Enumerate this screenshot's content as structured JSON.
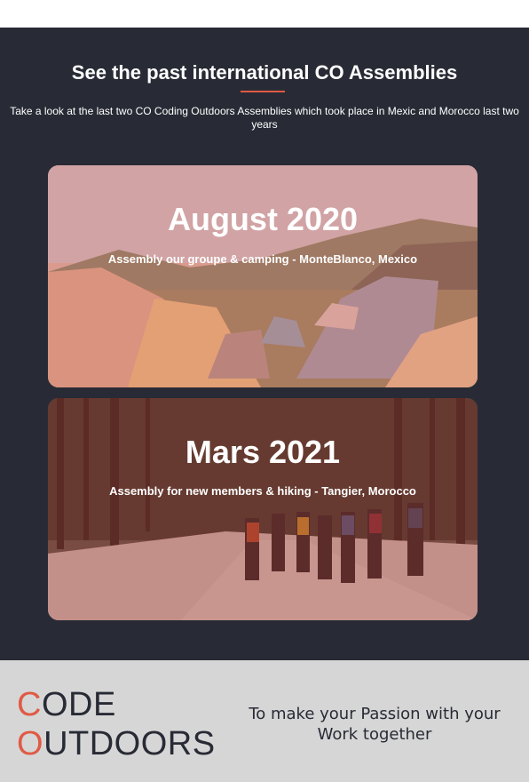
{
  "section": {
    "title": "See the past international CO Assemblies",
    "description": "Take a look at the last two CO Coding Outdoors Assemblies which took place in Mexic and Morocco last two years"
  },
  "cards": [
    {
      "title": "August 2020",
      "subtitle": "Assembly our groupe & camping - MonteBlanco, Mexico",
      "image": "camping-tents-photo"
    },
    {
      "title": "Mars 2021",
      "subtitle": "Assembly for new members & hiking - Tangier, Morocco",
      "image": "winter-hiking-photo"
    }
  ],
  "footer": {
    "logo_line1_first": "C",
    "logo_line1_rest": "ODE",
    "logo_line2_first": "O",
    "logo_line2_rest": "UTDOORS",
    "tagline": "To make your Passion with your Work together"
  },
  "colors": {
    "dark_bg": "#282b35",
    "accent": "#e05a45",
    "footer_bg": "#d6d6d6"
  }
}
